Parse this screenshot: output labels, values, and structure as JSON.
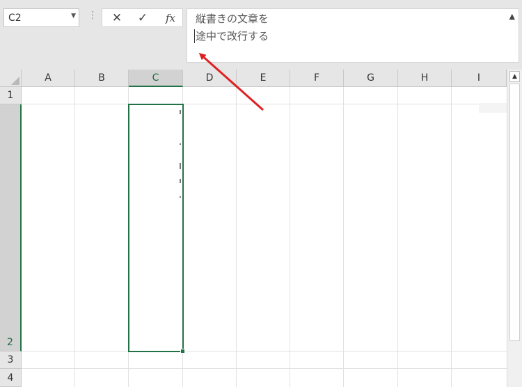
{
  "name_box": {
    "value": "C2"
  },
  "formula_bar": {
    "cancel_symbol": "✕",
    "enter_symbol": "✓",
    "fx_label": "fx",
    "content_lines": [
      "縦書きの文章を",
      "途中で改行する"
    ]
  },
  "columns": [
    "A",
    "B",
    "C",
    "D",
    "E",
    "F",
    "G",
    "H",
    "I"
  ],
  "rows": [
    "1",
    "2",
    "3",
    "4"
  ],
  "selection": {
    "column": "C",
    "row": "2"
  },
  "colors": {
    "accent": "#217346",
    "annotation_arrow": "#e02020"
  }
}
